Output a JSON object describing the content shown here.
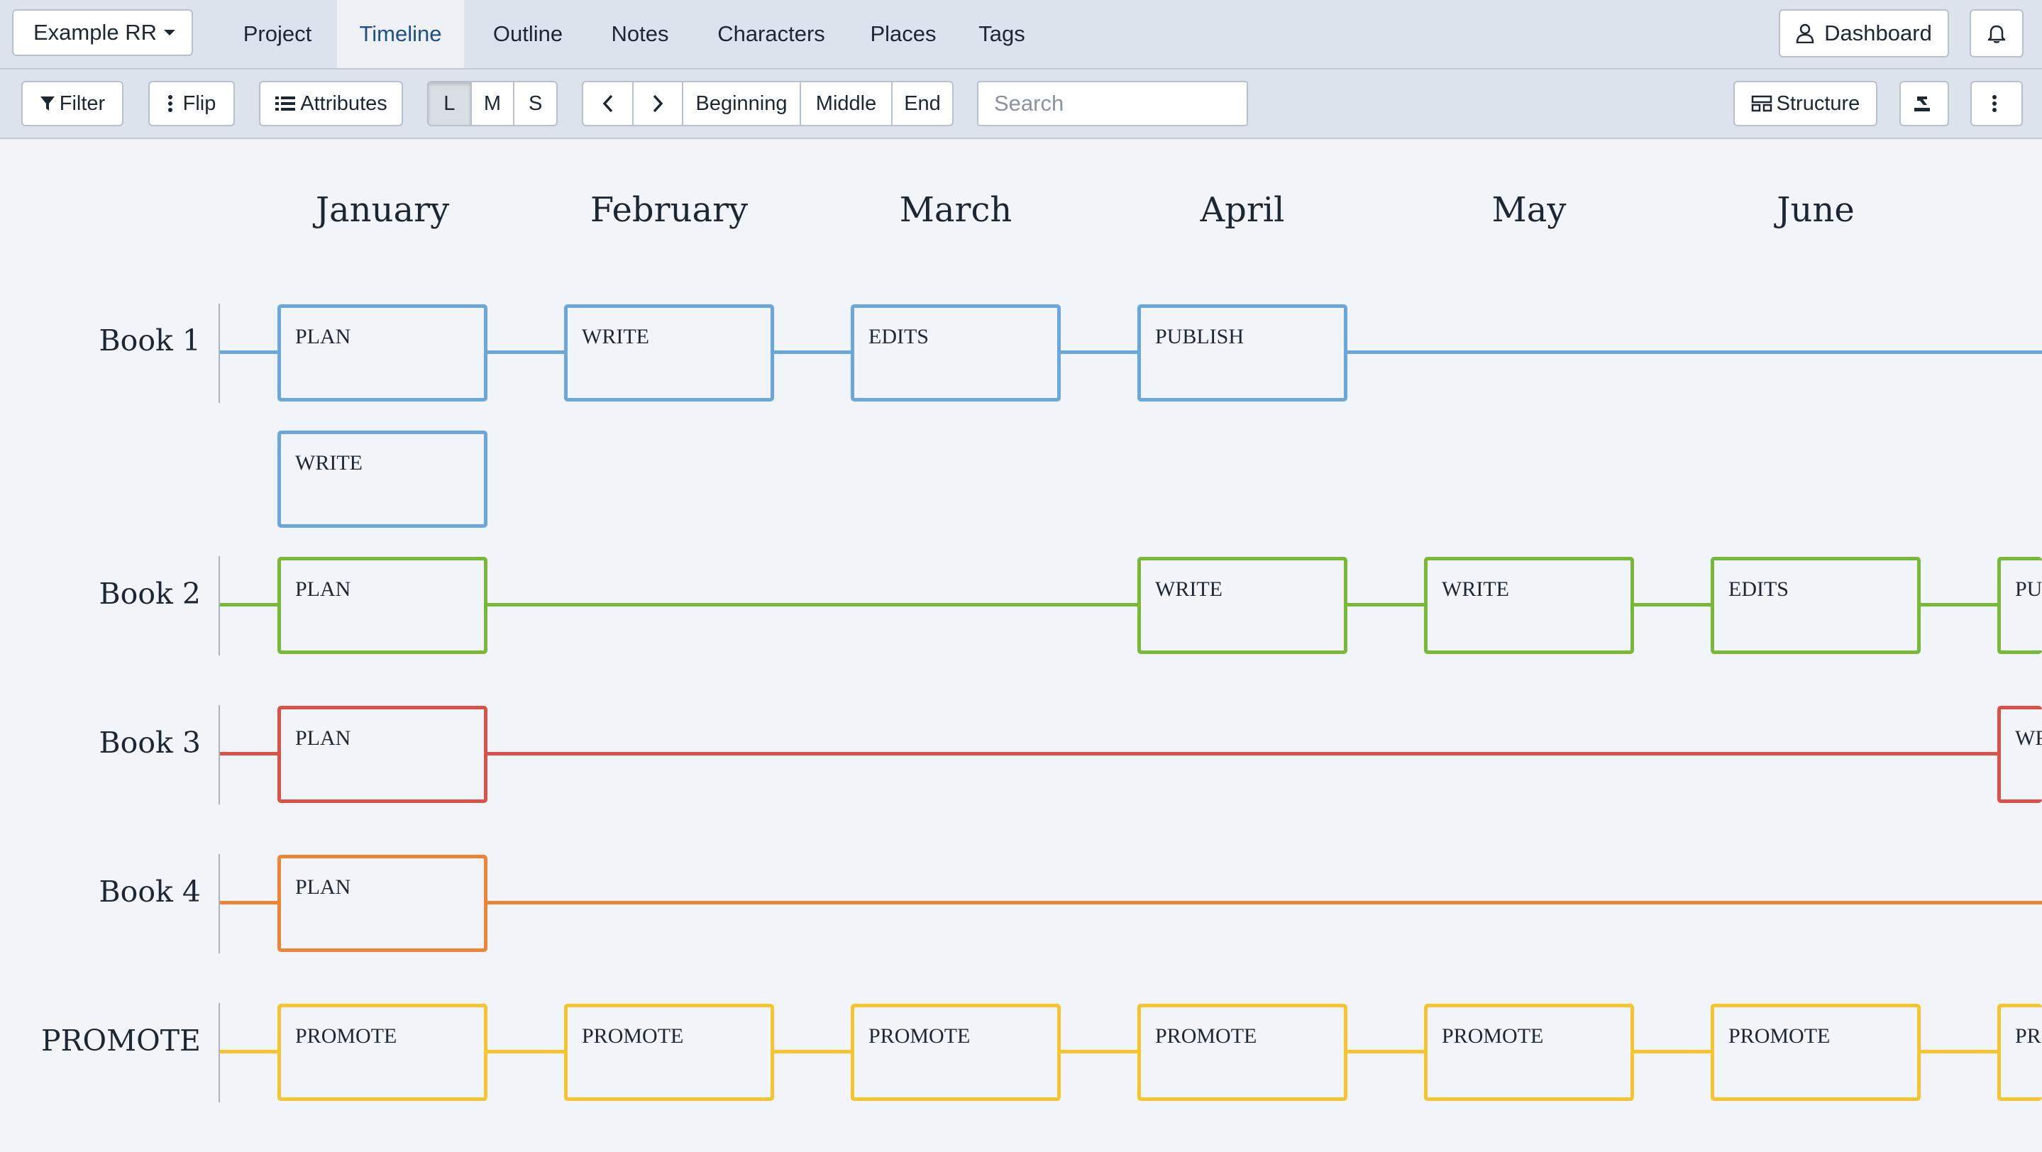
{
  "topnav": {
    "project": "Example RR",
    "tabs": [
      {
        "label": "Project"
      },
      {
        "label": "Timeline"
      },
      {
        "label": "Outline"
      },
      {
        "label": "Notes"
      },
      {
        "label": "Characters"
      },
      {
        "label": "Places"
      },
      {
        "label": "Tags"
      }
    ],
    "active_tab": "Timeline",
    "dashboard": "Dashboard"
  },
  "toolbar": {
    "filter": "Filter",
    "flip": "Flip",
    "attributes": "Attributes",
    "sizes": [
      "L",
      "M",
      "S"
    ],
    "active_size": "L",
    "jump": [
      "Beginning",
      "Middle",
      "End"
    ],
    "search_placeholder": "Search",
    "structure": "Structure"
  },
  "colors": {
    "book1": "#6aa7dc",
    "book2": "#78b936",
    "book3": "#db5047",
    "book4": "#ef8436",
    "promote": "#f7c42e",
    "active_tab_text": "#1f4e8c"
  },
  "timeline": {
    "months": [
      "January",
      "February",
      "March",
      "April",
      "May",
      "June"
    ],
    "rows": [
      {
        "label": "Book 1",
        "cards": [
          "PLAN",
          "WRITE",
          "EDITS",
          "PUBLISH"
        ],
        "extra": "WRITE"
      },
      {
        "label": "Book 2",
        "cards": [
          "PLAN",
          "WRITE",
          "WRITE",
          "EDITS",
          "PUBLISH"
        ]
      },
      {
        "label": "Book 3",
        "cards": [
          "PLAN",
          "WRITE"
        ]
      },
      {
        "label": "Book 4",
        "cards": [
          "PLAN"
        ]
      },
      {
        "label": "PROMOTE",
        "cards": [
          "PROMOTE",
          "PROMOTE",
          "PROMOTE",
          "PROMOTE",
          "PROMOTE",
          "PROMOTE",
          "PROMOTE"
        ]
      }
    ]
  }
}
